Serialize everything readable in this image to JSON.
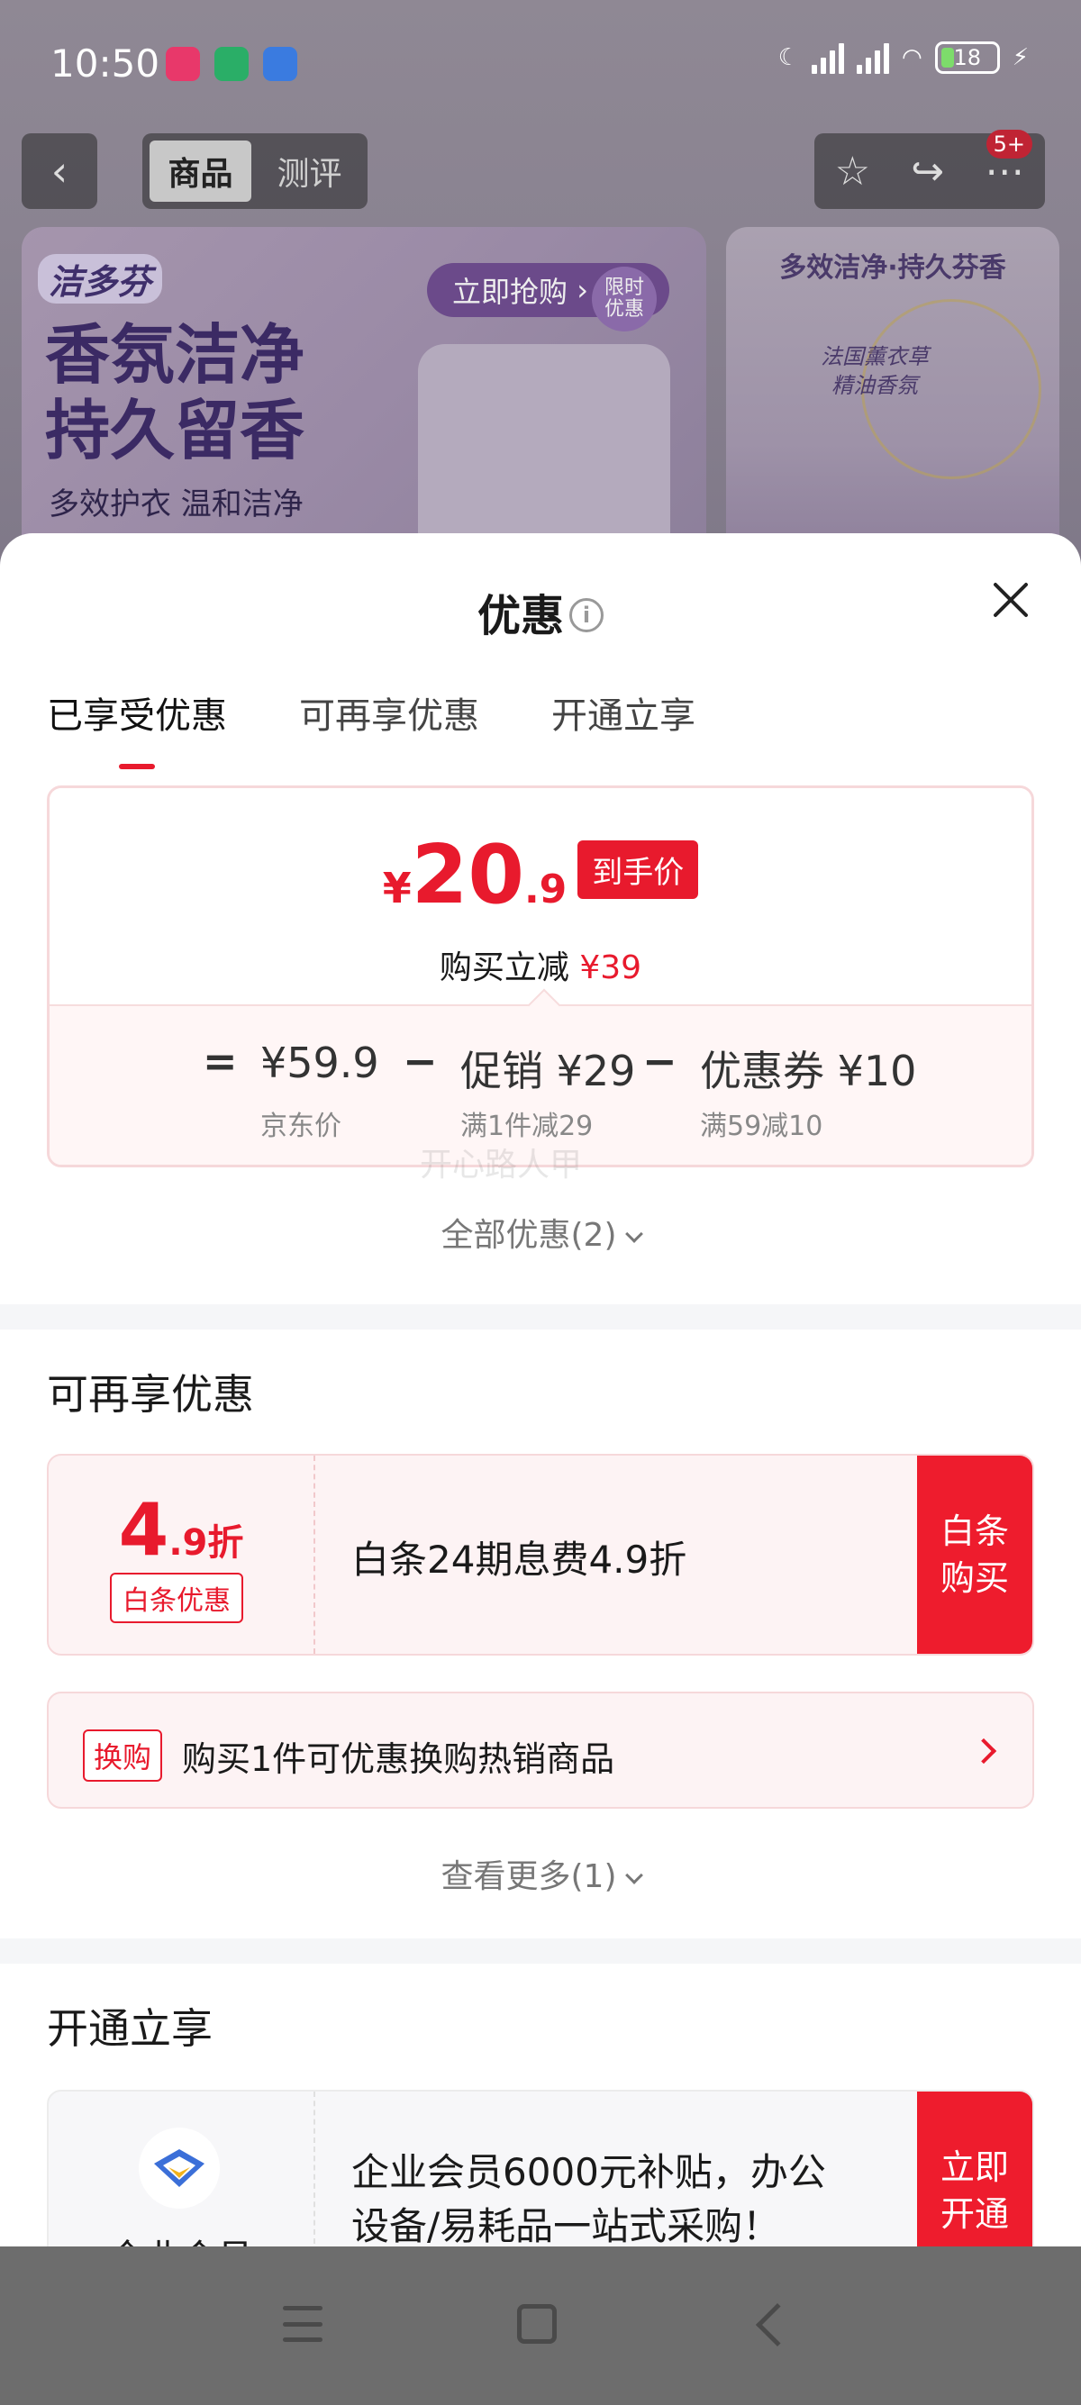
{
  "status_bar": {
    "time": "10:50",
    "battery": "18",
    "apps": [
      "app-red-icon",
      "wechat-icon",
      "shield-app-icon"
    ]
  },
  "top_nav": {
    "tabs": [
      "商品",
      "测评"
    ],
    "badge": "5+"
  },
  "banner": {
    "brand": "洁多芬",
    "title_line1": "香氛洁净",
    "title_line2": "持久留香",
    "subtitle": "多效护衣 温和洁净",
    "buy_now": "立即抢购",
    "limited_line1": "限时",
    "limited_line2": "优惠",
    "right_title": "多效洁净·持久芬香",
    "right_sub_line1": "法国薰衣草",
    "right_sub_line2": "精油香氛"
  },
  "sheet": {
    "title": "优惠",
    "tabs": [
      "已享受优惠",
      "可再享优惠",
      "开通立享"
    ],
    "price": {
      "currency": "¥",
      "integer": "20",
      "decimal": ".9",
      "tag": "到手价",
      "discount_prefix": "购买立减",
      "discount_value": "¥39"
    },
    "calc": {
      "eq": "=",
      "base_value": "¥59.9",
      "base_label": "京东价",
      "minus": "−",
      "promo_value": "促销 ¥29",
      "promo_label": "满1件减29",
      "coupon_value": "优惠券 ¥10",
      "coupon_label": "满59减10"
    },
    "watermark": "开心路人甲",
    "all_offers": "全部优惠(2)",
    "more_section_title": "可再享优惠",
    "baitiao": {
      "discount_big": "4",
      "discount_small": ".9折",
      "tag": "白条优惠",
      "text": "白条24期息费4.9折",
      "btn_line1": "白条",
      "btn_line2": "购买"
    },
    "swap": {
      "tag": "换购",
      "text": "购买1件可优惠换购热销商品"
    },
    "see_more": "查看更多(1)",
    "open_section_title": "开通立享",
    "enterprise": {
      "name": "企业会员",
      "text": "企业会员6000元补贴，办公设备/易耗品一站式采购！",
      "btn_line1": "立即",
      "btn_line2": "开通"
    }
  },
  "colors": {
    "accent_red": "#e81a2d",
    "sheet_bg": "#ffffff",
    "overlay": "#6f6f73"
  }
}
